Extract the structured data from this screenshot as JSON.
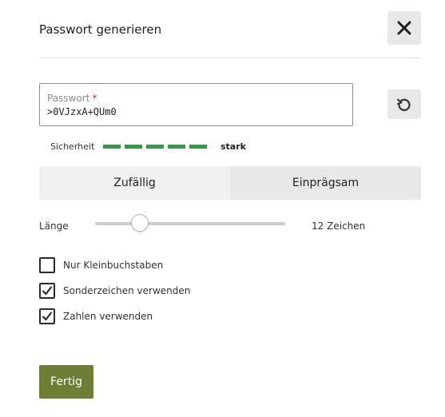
{
  "dialog": {
    "title": "Passwort generieren"
  },
  "password": {
    "label": "Passwort",
    "required_marker": "*",
    "value": ">0VJzxA+QUm0"
  },
  "strength": {
    "label": "Sicherheit",
    "value": "stark",
    "filled_segments": 5,
    "total_segments": 5,
    "color": "#27a043"
  },
  "tabs": [
    {
      "label": "Zufällig",
      "active": true
    },
    {
      "label": "Einprägsam",
      "active": false
    }
  ],
  "length": {
    "label": "Länge",
    "value_text": "12 Zeichen",
    "slider_fraction": 0.235
  },
  "options": [
    {
      "label": "Nur Kleinbuchstaben",
      "checked": false
    },
    {
      "label": "Sonderzeichen verwenden",
      "checked": true
    },
    {
      "label": "Zahlen verwenden",
      "checked": true
    }
  ],
  "actions": {
    "done_label": "Fertig"
  },
  "icons": {
    "close": "close-icon",
    "refresh": "refresh-icon",
    "checkmark": "checkmark-icon"
  },
  "colors": {
    "primary_button": "#6d7f35",
    "required": "#c0392b"
  }
}
